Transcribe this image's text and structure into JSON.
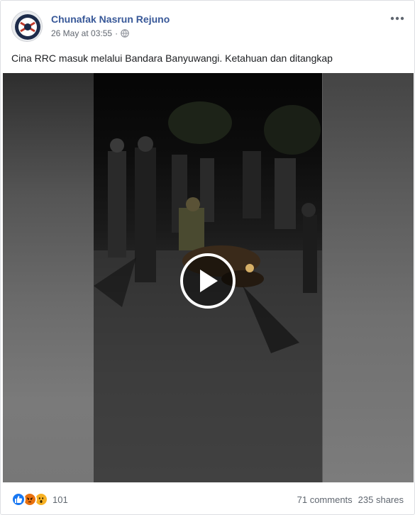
{
  "post": {
    "author": "Chunafak Nasrun Rejuno",
    "date": "26 May at 03:55",
    "separator": "·",
    "privacy_icon": "globe-icon",
    "text": "Cina RRC masuk melalui Bandara Banyuwangi. Ketahuan dan ditangkap"
  },
  "video": {
    "play_icon": "play-icon"
  },
  "footer": {
    "reactions": [
      "like-icon",
      "angry-icon",
      "wow-icon"
    ],
    "reaction_count": "101",
    "comments": "71 comments",
    "shares": "235 shares"
  },
  "colors": {
    "author_link": "#385898",
    "like": "#1877f2",
    "reaction_yellow": "#f7b125",
    "angry": "#e9710f",
    "meta_text": "#616770"
  }
}
